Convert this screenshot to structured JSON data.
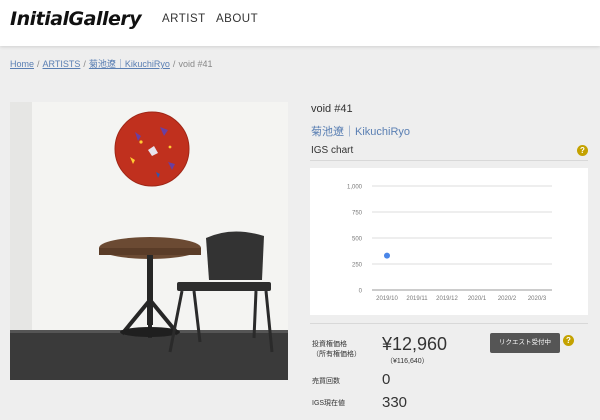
{
  "header": {
    "logo": "InitialGallery",
    "nav": [
      "ARTIST",
      "ABOUT"
    ]
  },
  "breadcrumb": {
    "home": "Home",
    "artists": "ARTISTS",
    "artist": "菊池遼｜KikuchiRyo",
    "current": "void #41"
  },
  "artwork": {
    "title": "void #41",
    "artist": "菊池遼｜KikuchiRyo"
  },
  "igs": {
    "label": "IGS chart",
    "help": "?"
  },
  "chart_data": {
    "type": "scatter",
    "x": [
      "2019/10",
      "2019/11",
      "2019/12",
      "2020/1",
      "2020/2",
      "2020/3"
    ],
    "y_ticks": [
      "1,000",
      "750",
      "500",
      "250",
      "0"
    ],
    "ylim": [
      0,
      1000
    ],
    "points": [
      {
        "x": "2019/10",
        "y": 330
      }
    ],
    "point_color": "#4a86e8",
    "grid": true
  },
  "price": {
    "label_line1": "投資権価格",
    "label_line2": "（所有権価格）",
    "value": "¥12,960",
    "sub_value": "（¥116,640）",
    "request_button": "リクエスト受付中",
    "help": "?"
  },
  "sales": {
    "label": "売買回数",
    "value": "0"
  },
  "igs_current": {
    "label": "IGS現在値",
    "value": "330"
  }
}
